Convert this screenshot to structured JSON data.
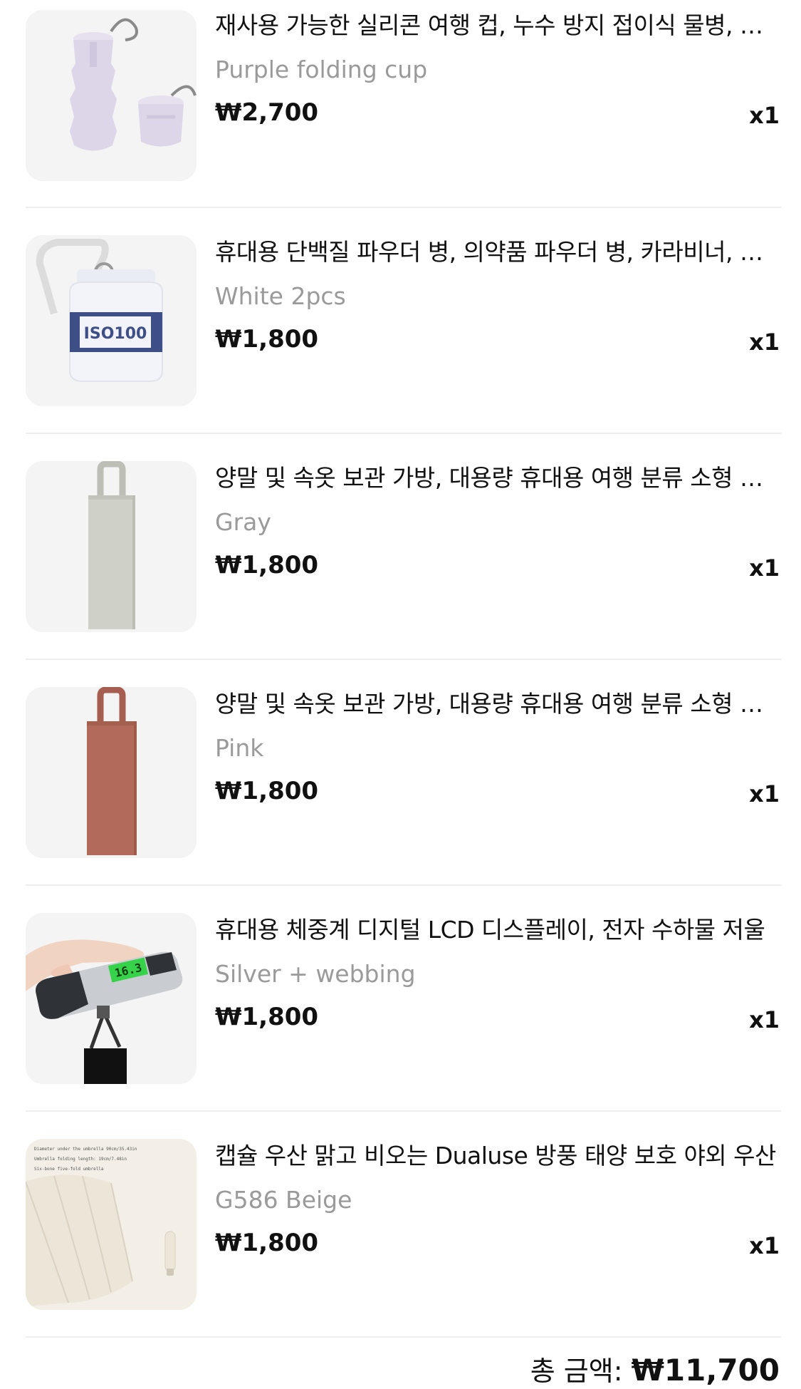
{
  "items": [
    {
      "title": "재사용 가능한 실리콘 여행 컵, 누수 방지 접이식 물병, 휴대용",
      "variant": "Purple folding cup",
      "price": "₩2,700",
      "qty": "x1",
      "image_icon": "folding-cup-image"
    },
    {
      "title": "휴대용 단백질 파우더 병, 의약품 파우더 병, 카라비너, 야외",
      "variant": "White 2pcs",
      "price": "₩1,800",
      "qty": "x1",
      "image_icon": "powder-bottle-image",
      "image_text": "ISO100"
    },
    {
      "title": "양말 및 속옷 보관 가방, 대용량 휴대용 여행 분류 소형 주머니",
      "variant": "Gray",
      "price": "₩1,800",
      "qty": "x1",
      "image_icon": "storage-bag-image"
    },
    {
      "title": "양말 및 속옷 보관 가방, 대용량 휴대용 여행 분류 소형 주머니",
      "variant": "Pink",
      "price": "₩1,800",
      "qty": "x1",
      "image_icon": "storage-bag-image"
    },
    {
      "title": "휴대용 체중계 디지털 LCD 디스플레이, 전자 수하물 저울",
      "variant": "Silver + webbing",
      "price": "₩1,800",
      "qty": "x1",
      "image_icon": "luggage-scale-image",
      "image_text": "16.3"
    },
    {
      "title": "캡슐 우산 맑고 비오는 Dualuse 방풍 태양 보호 야외 우산",
      "variant": "G586 Beige",
      "price": "₩1,800",
      "qty": "x1",
      "image_icon": "capsule-umbrella-image",
      "image_text": [
        "Diameter under the umbrella 90cm/35.43in",
        "Umbrella folding length: 19cm/7.48in",
        "Six-bone five-fold umbrella"
      ]
    }
  ],
  "total": {
    "label": "총 금액:",
    "amount": "₩11,700"
  },
  "colors": {
    "cup": "#ddd6e8",
    "gray_bag": "#cfd0c8",
    "pink_bag": "#b26a5b",
    "scale_body": "#c9ccd0",
    "lcd": "#35d24a",
    "umbrella": "#ece6d8"
  }
}
